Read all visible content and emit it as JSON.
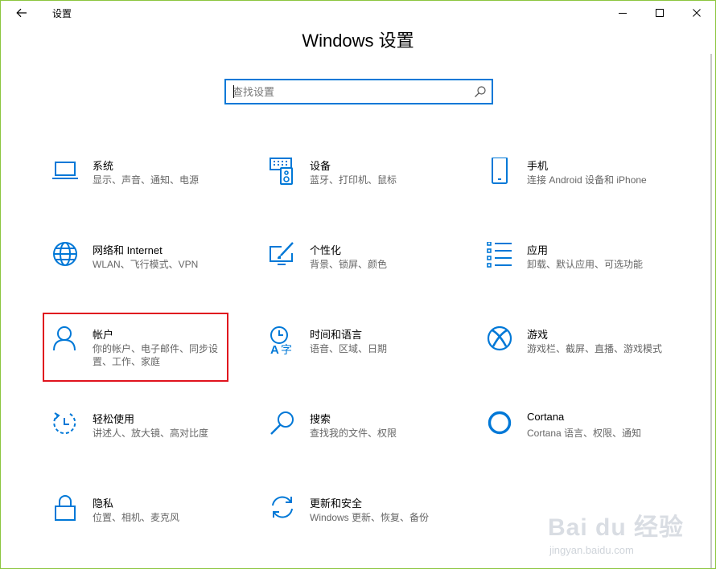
{
  "window": {
    "app_title": "设置",
    "heading": "Windows 设置"
  },
  "search": {
    "placeholder": "查找设置",
    "value": ""
  },
  "colors": {
    "accent": "#0078d7",
    "highlight_box": "#e0141e"
  },
  "tiles": [
    {
      "title": "系统",
      "desc": "显示、声音、通知、电源",
      "icon": "laptop-icon"
    },
    {
      "title": "设备",
      "desc": "蓝牙、打印机、鼠标",
      "icon": "keyboard-device-icon"
    },
    {
      "title": "手机",
      "desc": "连接 Android 设备和 iPhone",
      "icon": "phone-icon"
    },
    {
      "title": "网络和 Internet",
      "desc": "WLAN、飞行模式、VPN",
      "icon": "globe-icon"
    },
    {
      "title": "个性化",
      "desc": "背景、锁屏、颜色",
      "icon": "paint-monitor-icon"
    },
    {
      "title": "应用",
      "desc": "卸载、默认应用、可选功能",
      "icon": "app-list-icon"
    },
    {
      "title": "帐户",
      "desc": "你的帐户、电子邮件、同步设置、工作、家庭",
      "icon": "person-icon"
    },
    {
      "title": "时间和语言",
      "desc": "语音、区域、日期",
      "icon": "time-language-icon"
    },
    {
      "title": "游戏",
      "desc": "游戏栏、截屏、直播、游戏模式",
      "icon": "xbox-icon"
    },
    {
      "title": "轻松使用",
      "desc": "讲述人、放大镜、高对比度",
      "icon": "ease-of-access-icon"
    },
    {
      "title": "搜索",
      "desc": "查找我的文件、权限",
      "icon": "magnifier-icon"
    },
    {
      "title": "Cortana",
      "desc": "Cortana 语言、权限、通知",
      "icon": "cortana-ring-icon"
    },
    {
      "title": "隐私",
      "desc": "位置、相机、麦克风",
      "icon": "lock-icon"
    },
    {
      "title": "更新和安全",
      "desc": "Windows 更新、恢复、备份",
      "icon": "sync-arrows-icon"
    }
  ],
  "watermark": {
    "brand": "Bai du 经验",
    "url": "jingyan.baidu.com"
  }
}
